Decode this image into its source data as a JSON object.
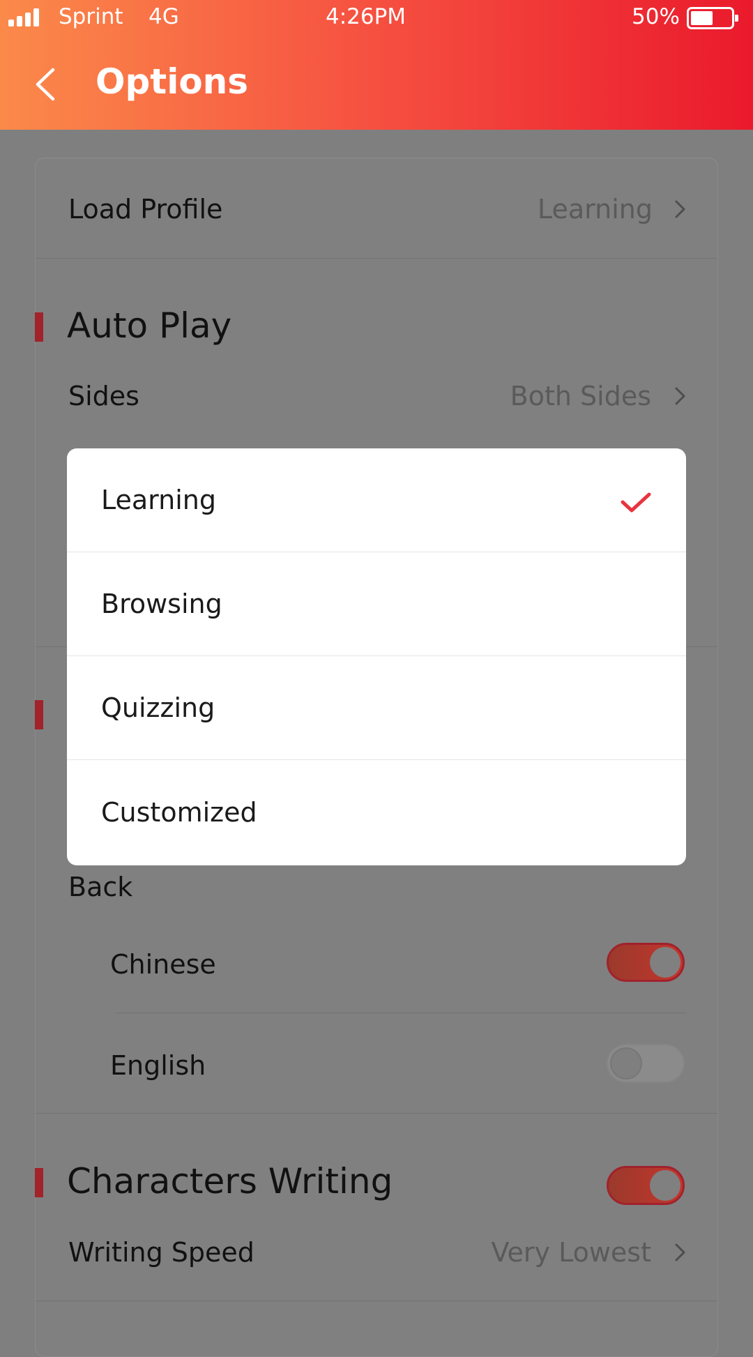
{
  "status_bar": {
    "carrier": "Sprint",
    "network": "4G",
    "time": "4:26PM",
    "battery_percent": "50%",
    "battery_level": 0.5
  },
  "header": {
    "title": "Options",
    "back_icon": "chevron-left-icon",
    "gradient": [
      "#fb8a4a",
      "#ea1a2c"
    ]
  },
  "settings": {
    "load_profile": {
      "label": "Load Profile",
      "value": "Learning"
    },
    "auto_play": {
      "title": "Auto Play",
      "sides": {
        "label": "Sides",
        "value": "Both Sides"
      }
    },
    "back": {
      "label": "Back",
      "chinese": {
        "label": "Chinese",
        "enabled": true
      },
      "english": {
        "label": "English",
        "enabled": false
      }
    },
    "characters_writing": {
      "title": "Characters Writing",
      "enabled": true,
      "writing_speed": {
        "label": "Writing Speed",
        "value": "Very Lowest"
      }
    }
  },
  "profile_picker": {
    "selected": "Learning",
    "options": [
      "Learning",
      "Browsing",
      "Quizzing",
      "Customized"
    ]
  },
  "colors": {
    "accent": "#e8343f",
    "section_marker": "#a1232b",
    "overlay": "#7f7f7f"
  }
}
